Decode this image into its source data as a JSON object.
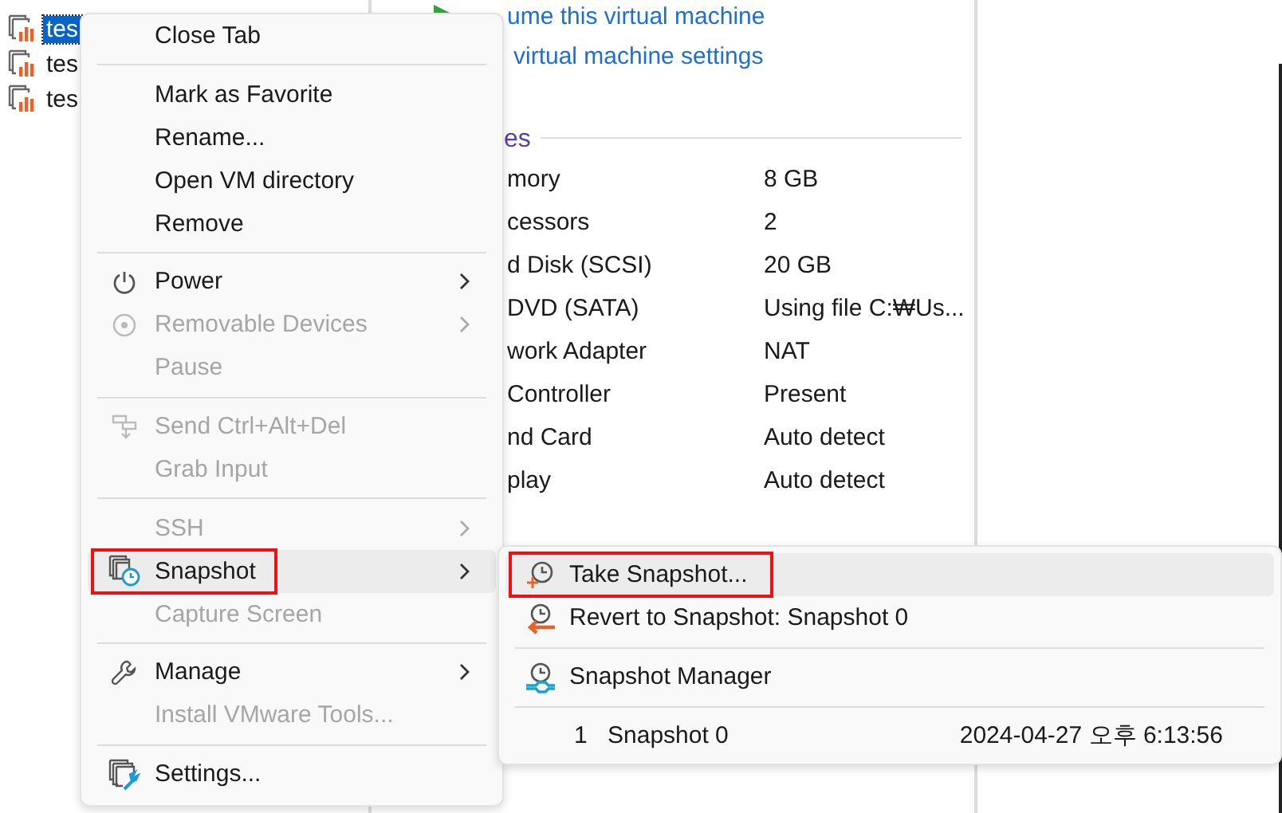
{
  "tree": {
    "items": [
      {
        "label": "tes",
        "selected": true
      },
      {
        "label": "tes",
        "selected": false
      },
      {
        "label": "tes",
        "selected": false
      }
    ]
  },
  "actions": [
    "ume this virtual machine",
    "virtual machine settings"
  ],
  "devices": {
    "header": "es",
    "rows": [
      {
        "name": "mory",
        "value": "8 GB"
      },
      {
        "name": "cessors",
        "value": "2"
      },
      {
        "name": "d Disk (SCSI)",
        "value": "20 GB"
      },
      {
        "name": "DVD (SATA)",
        "value": "Using file C:₩Us..."
      },
      {
        "name": "work Adapter",
        "value": "NAT"
      },
      {
        "name": "Controller",
        "value": "Present"
      },
      {
        "name": "nd Card",
        "value": "Auto detect"
      },
      {
        "name": "play",
        "value": "Auto detect"
      }
    ]
  },
  "context_menu": {
    "items": [
      {
        "kind": "item",
        "label": "Close Tab",
        "disabled": false,
        "submenu": false,
        "selected": false,
        "annotated": false
      },
      {
        "kind": "separator"
      },
      {
        "kind": "item",
        "label": "Mark as Favorite",
        "disabled": false,
        "submenu": false,
        "selected": false,
        "annotated": false
      },
      {
        "kind": "item",
        "label": "Rename...",
        "disabled": false,
        "submenu": false,
        "selected": false,
        "annotated": false
      },
      {
        "kind": "item",
        "label": "Open VM directory",
        "disabled": false,
        "submenu": false,
        "selected": false,
        "annotated": false
      },
      {
        "kind": "item",
        "label": "Remove",
        "disabled": false,
        "submenu": false,
        "selected": false,
        "annotated": false
      },
      {
        "kind": "separator"
      },
      {
        "kind": "item",
        "label": "Power",
        "disabled": false,
        "submenu": true,
        "selected": false,
        "annotated": false
      },
      {
        "kind": "item",
        "label": "Removable Devices",
        "disabled": true,
        "submenu": true,
        "selected": false,
        "annotated": false
      },
      {
        "kind": "item",
        "label": "Pause",
        "disabled": true,
        "submenu": false,
        "selected": false,
        "annotated": false
      },
      {
        "kind": "separator"
      },
      {
        "kind": "item",
        "label": "Send Ctrl+Alt+Del",
        "disabled": true,
        "submenu": false,
        "selected": false,
        "annotated": false
      },
      {
        "kind": "item",
        "label": "Grab Input",
        "disabled": true,
        "submenu": false,
        "selected": false,
        "annotated": false
      },
      {
        "kind": "separator"
      },
      {
        "kind": "item",
        "label": "SSH",
        "disabled": true,
        "submenu": true,
        "selected": false,
        "annotated": false
      },
      {
        "kind": "item",
        "label": "Snapshot",
        "disabled": false,
        "submenu": true,
        "selected": true,
        "annotated": true
      },
      {
        "kind": "item",
        "label": "Capture Screen",
        "disabled": true,
        "submenu": false,
        "selected": false,
        "annotated": false
      },
      {
        "kind": "separator"
      },
      {
        "kind": "item",
        "label": "Manage",
        "disabled": false,
        "submenu": true,
        "selected": false,
        "annotated": false
      },
      {
        "kind": "item",
        "label": "Install VMware Tools...",
        "disabled": true,
        "submenu": false,
        "selected": false,
        "annotated": false
      },
      {
        "kind": "separator"
      },
      {
        "kind": "item",
        "label": "Settings...",
        "disabled": false,
        "submenu": false,
        "selected": false,
        "annotated": false
      }
    ]
  },
  "snapshot_menu": {
    "items": [
      {
        "kind": "item",
        "label": "Take Snapshot...",
        "selected": true,
        "annotated": true
      },
      {
        "kind": "item",
        "label": "Revert to Snapshot: Snapshot 0",
        "selected": false,
        "annotated": false
      },
      {
        "kind": "separator"
      },
      {
        "kind": "item",
        "label": "Snapshot Manager",
        "selected": false,
        "annotated": false
      },
      {
        "kind": "separator"
      },
      {
        "kind": "snapshot",
        "number": "1",
        "name": "Snapshot 0",
        "date": "2024-04-27 오후 6:13:56"
      }
    ]
  }
}
